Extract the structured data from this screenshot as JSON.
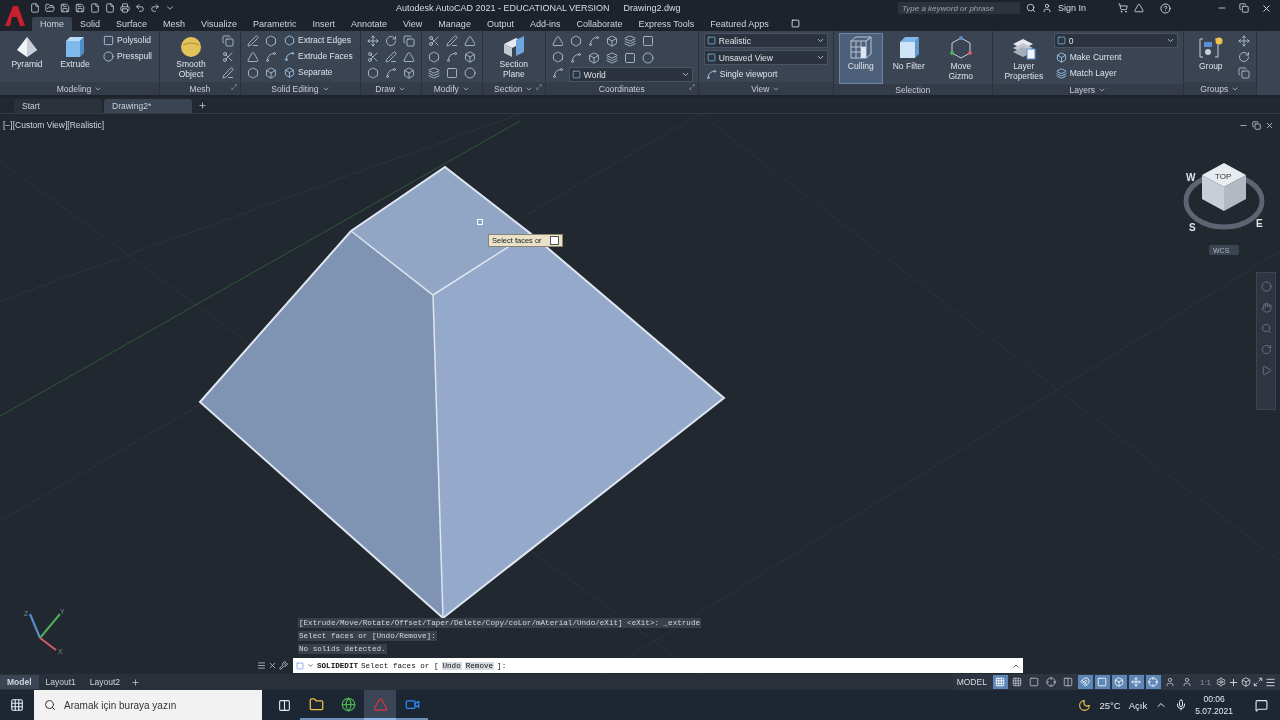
{
  "title_bar": {
    "title": "Autodesk AutoCAD 2021 - EDUCATIONAL VERSION",
    "file": "Drawing2.dwg",
    "search": {
      "placeholder": "Type a keyword or phrase"
    },
    "sign_in": "Sign In"
  },
  "ribbon_tabs": [
    {
      "label": "Home",
      "selected": true
    },
    {
      "label": "Solid",
      "selected": false
    },
    {
      "label": "Surface",
      "selected": false
    },
    {
      "label": "Mesh",
      "selected": false
    },
    {
      "label": "Visualize",
      "selected": false
    },
    {
      "label": "Parametric",
      "selected": false
    },
    {
      "label": "Insert",
      "selected": false
    },
    {
      "label": "Annotate",
      "selected": false
    },
    {
      "label": "View",
      "selected": false
    },
    {
      "label": "Manage",
      "selected": false
    },
    {
      "label": "Output",
      "selected": false
    },
    {
      "label": "Add-ins",
      "selected": false
    },
    {
      "label": "Collaborate",
      "selected": false
    },
    {
      "label": "Express Tools",
      "selected": false
    },
    {
      "label": "Featured Apps",
      "selected": false
    }
  ],
  "ribbon_panels": [
    {
      "title": "Modeling",
      "has_menu": true,
      "launcher": false,
      "items": [
        {
          "kind": "large",
          "label": "Pyramid",
          "on": false
        },
        {
          "kind": "large",
          "label": "Extrude",
          "on": false
        },
        {
          "kind": "stack",
          "items": [
            {
              "kind": "small",
              "label": "Polysolid"
            },
            {
              "kind": "small",
              "label": "Presspull"
            }
          ]
        }
      ]
    },
    {
      "title": "Mesh",
      "has_menu": false,
      "launcher": true,
      "items": [
        {
          "kind": "large",
          "label": "Smooth Object",
          "on": false
        },
        {
          "kind": "tool_column"
        }
      ]
    },
    {
      "title": "Solid Editing",
      "has_menu": true,
      "launcher": false,
      "items": [
        {
          "kind": "tool_column"
        },
        {
          "kind": "tool_column"
        },
        {
          "kind": "stack",
          "items": [
            {
              "kind": "small",
              "label": "Extract Edges"
            },
            {
              "kind": "small",
              "label": "Extrude Faces"
            },
            {
              "kind": "small",
              "label": "Separate"
            }
          ]
        }
      ]
    },
    {
      "title": "Draw",
      "has_menu": true,
      "launcher": false,
      "items": [
        {
          "kind": "tools"
        }
      ]
    },
    {
      "title": "Modify",
      "has_menu": true,
      "launcher": false,
      "items": [
        {
          "kind": "tools"
        }
      ]
    },
    {
      "title": "Section",
      "has_menu": true,
      "launcher": true,
      "items": [
        {
          "kind": "large",
          "label": "Section Plane",
          "on": false
        }
      ]
    },
    {
      "title": "Coordinates",
      "has_menu": false,
      "launcher": true,
      "items": [
        {
          "kind": "tool_column"
        },
        {
          "kind": "stack",
          "items": [
            {
              "kind": "tools_row"
            },
            {
              "kind": "tools_row"
            },
            {
              "kind": "dropdown",
              "value": "World"
            }
          ]
        }
      ]
    },
    {
      "title": "View",
      "has_menu": true,
      "launcher": false,
      "items": [
        {
          "kind": "stack",
          "items": [
            {
              "kind": "dropdown",
              "value": "Realistic"
            },
            {
              "kind": "dropdown",
              "value": "Unsaved View"
            },
            {
              "kind": "small",
              "label": "Single viewport"
            }
          ]
        }
      ]
    },
    {
      "title": "Selection",
      "has_menu": false,
      "launcher": false,
      "items": [
        {
          "kind": "large",
          "label": "Culling",
          "on": true
        },
        {
          "kind": "large",
          "label": "No Filter",
          "on": false
        },
        {
          "kind": "large",
          "label": "Move Gizmo",
          "on": false
        }
      ]
    },
    {
      "title": "Layers",
      "has_menu": true,
      "launcher": false,
      "items": [
        {
          "kind": "large",
          "label": "Layer Properties",
          "on": false
        },
        {
          "kind": "stack",
          "items": [
            {
              "kind": "dropdown",
              "value": "0"
            },
            {
              "kind": "small",
              "label": "Make Current"
            },
            {
              "kind": "small",
              "label": "Match Layer"
            }
          ]
        }
      ]
    },
    {
      "title": "Groups",
      "has_menu": true,
      "launcher": false,
      "items": [
        {
          "kind": "large",
          "label": "Group",
          "on": false
        },
        {
          "kind": "tool_column"
        }
      ]
    }
  ],
  "doc_tabs": [
    {
      "label": "Start",
      "selected": false
    },
    {
      "label": "Drawing2*",
      "selected": true
    }
  ],
  "viewport": {
    "controls": [
      "[−]",
      "[Custom View]",
      "[Realistic]"
    ],
    "tooltip": "Select faces or",
    "viewcube": {
      "top": "TOP",
      "compass": [
        "W",
        "S",
        "E"
      ],
      "ucs": "WCS"
    },
    "ucs_axes": [
      "Z",
      "Y",
      "X"
    ]
  },
  "command_history": [
    "[Extrude/Move/Rotate/Offset/Taper/Delete/Copy/coLor/mAterial/Undo/eXit] <eXit>: _extrude",
    "Select faces or [Undo/Remove]:",
    "No solids detected."
  ],
  "command_line": {
    "command": "SOLIDEDIT",
    "prompt": "Select faces or [",
    "options": [
      "Undo",
      "Remove"
    ],
    "suffix": "]:"
  },
  "layout_tabs": [
    {
      "label": "Model",
      "selected": true
    },
    {
      "label": "Layout1",
      "selected": false
    },
    {
      "label": "Layout2",
      "selected": false
    }
  ],
  "status_bar": {
    "space": "MODEL",
    "toggles": [
      {
        "on": true
      },
      {
        "on": false
      },
      {
        "on": false
      },
      {
        "on": false
      },
      {
        "on": false
      },
      {
        "on": true
      },
      {
        "on": true
      },
      {
        "on": true
      },
      {
        "on": true
      },
      {
        "on": true
      },
      {
        "on": false
      },
      {
        "on": false
      }
    ],
    "scale": "1:1"
  },
  "taskbar": {
    "search": {
      "placeholder": "Aramak için buraya yazın"
    },
    "apps": [
      {
        "selected": false
      },
      {
        "selected": false
      },
      {
        "selected": true
      },
      {
        "selected": false
      }
    ],
    "temperature": "25°C",
    "weather": "Açık",
    "time": "00:06",
    "date": "5.07.2021"
  }
}
